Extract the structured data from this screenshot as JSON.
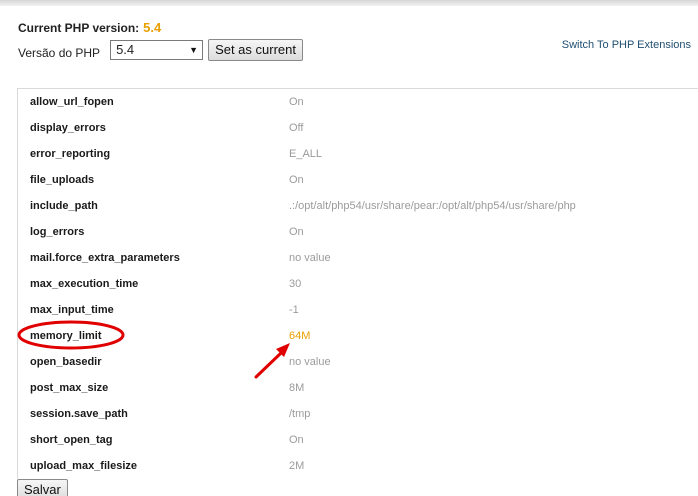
{
  "header": {
    "current_label": "Current PHP version:",
    "current_value": "5.4",
    "version_label": "Versão do PHP",
    "selected_version": "5.4",
    "set_button": "Set as current",
    "switch_link": "Switch To PHP Extensions"
  },
  "options": [
    {
      "name": "allow_url_fopen",
      "value": "On"
    },
    {
      "name": "display_errors",
      "value": "Off"
    },
    {
      "name": "error_reporting",
      "value": "E_ALL"
    },
    {
      "name": "file_uploads",
      "value": "On"
    },
    {
      "name": "include_path",
      "value": ".:/opt/alt/php54/usr/share/pear:/opt/alt/php54/usr/share/php"
    },
    {
      "name": "log_errors",
      "value": "On"
    },
    {
      "name": "mail.force_extra_parameters",
      "value": "no value"
    },
    {
      "name": "max_execution_time",
      "value": "30"
    },
    {
      "name": "max_input_time",
      "value": "-1"
    },
    {
      "name": "memory_limit",
      "value": "64M"
    },
    {
      "name": "open_basedir",
      "value": "no value"
    },
    {
      "name": "post_max_size",
      "value": "8M"
    },
    {
      "name": "session.save_path",
      "value": "/tmp"
    },
    {
      "name": "short_open_tag",
      "value": "On"
    },
    {
      "name": "upload_max_filesize",
      "value": "2M"
    }
  ],
  "footer": {
    "save_button": "Salvar"
  },
  "colors": {
    "accent_orange": "#e8a000",
    "annotation_red": "#e00000",
    "link_blue": "#1f4e70"
  }
}
